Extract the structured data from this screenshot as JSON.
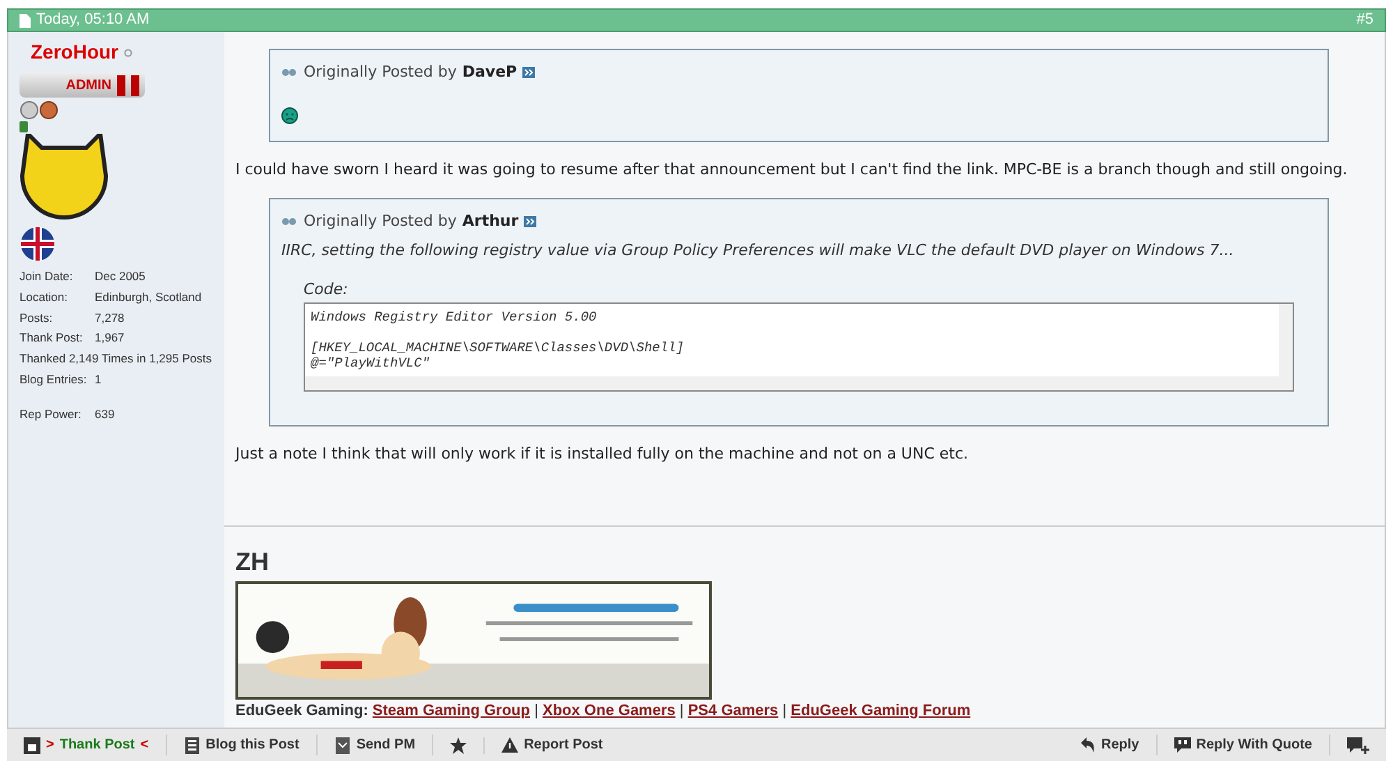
{
  "post_header": {
    "date": "Today, 05:10 AM",
    "number": "#5"
  },
  "user": {
    "name": "ZeroHour",
    "rank": "ADMIN",
    "stats": [
      {
        "label": "Join Date:",
        "value": "Dec 2005"
      },
      {
        "label": "Location:",
        "value": "Edinburgh, Scotland"
      },
      {
        "label": "Posts:",
        "value": "7,278"
      },
      {
        "label": "Thank Post:",
        "value": "1,967"
      },
      {
        "text": "Thanked 2,149 Times in 1,295 Posts"
      },
      {
        "label": "Blog Entries:",
        "value": "1"
      }
    ],
    "rep": {
      "label": "Rep Power:",
      "value": "639"
    }
  },
  "body": [
    {
      "kind": "quote",
      "prefix": "Originally Posted by",
      "author": "DaveP",
      "smiley": true
    },
    {
      "kind": "text",
      "text": "I could have sworn I heard it was going to resume after that announcement but I can't find the link. MPC-BE is a branch though and still ongoing."
    },
    {
      "kind": "quote",
      "prefix": "Originally Posted by",
      "author": "Arthur",
      "text": "IIRC, setting the following registry value via Group Policy Preferences will make VLC the default DVD player on Windows 7...",
      "code_label": "Code:",
      "code": [
        [
          "Windows Registry Editor Version 5.00"
        ],
        [
          "[HKEY_LOCAL_MACHINE\\SOFTWARE\\Classes\\DVD\\Shell]",
          "@=\"PlayWithVLC\""
        ]
      ]
    },
    {
      "kind": "text",
      "text": "Just a note I think that will only work if it is installed fully on the machine and not on a UNC etc."
    }
  ],
  "signature": {
    "initials": "ZH",
    "links_label": "EduGeek Gaming:",
    "separator": "|",
    "links": [
      "Steam Gaming Group",
      "Xbox One Gamers",
      "PS4 Gamers",
      "EduGeek Gaming Forum"
    ]
  },
  "footer": {
    "thank": {
      "prefix": ">",
      "label": "Thank Post",
      "suffix": "<"
    },
    "left": [
      {
        "kind": "blog",
        "label": "Blog this Post"
      },
      {
        "kind": "pm",
        "label": "Send PM"
      },
      {
        "kind": "star"
      },
      {
        "kind": "report",
        "label": "Report Post"
      }
    ],
    "right": [
      {
        "kind": "reply",
        "label": "Reply"
      },
      {
        "kind": "quote",
        "label": "Reply With Quote"
      },
      {
        "kind": "multiquote"
      }
    ]
  }
}
